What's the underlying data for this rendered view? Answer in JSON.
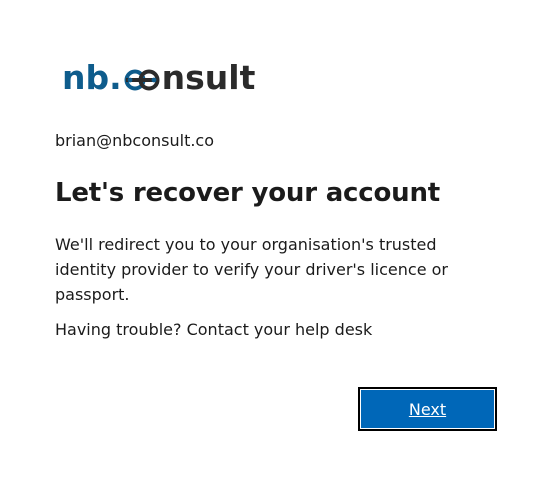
{
  "logo": {
    "prefix": "nb",
    "dot": ".",
    "suffix": "nsult",
    "brand_color": "#0e5c8c",
    "text_color": "#2b2b2b",
    "icon": "linked-rings-icon"
  },
  "account": {
    "email": "brian@nbconsult.co"
  },
  "main": {
    "title": "Let's recover your account",
    "description": "We'll redirect you to your organisation's trusted identity provider to verify your driver's licence or passport.",
    "help_text": "Having trouble? Contact your help desk"
  },
  "actions": {
    "next_label": "Next",
    "accent_color": "#0067b8"
  }
}
